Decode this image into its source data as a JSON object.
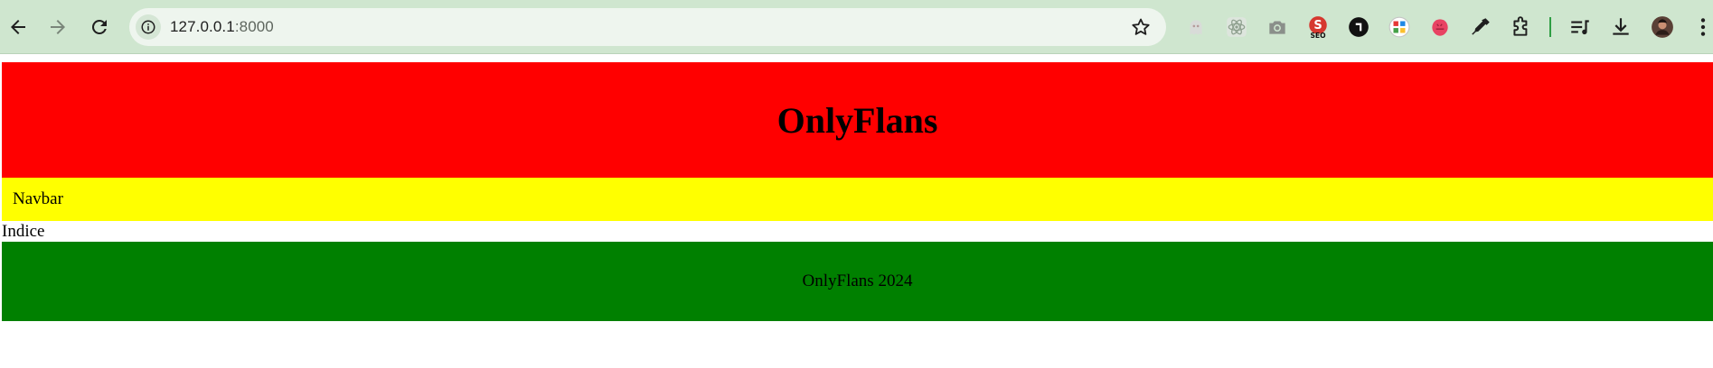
{
  "browser": {
    "url_host": "127.0.0.1",
    "url_port": ":8000",
    "extensions": [
      "ghost-extension-icon",
      "react-devtools-icon",
      "camera-icon",
      "seo-icon",
      "dark-circle-extension-icon",
      "color-grid-icon",
      "raspberry-icon",
      "eyedropper-icon",
      "puzzle-extensions-icon",
      "reading-list-icon",
      "download-icon",
      "profile-avatar",
      "kebab-menu-icon"
    ],
    "colors": {
      "toolbar_bg": "#cfe6cf",
      "omnibox_bg": "#eef5ee",
      "icon": "#1f1f1f"
    }
  },
  "page": {
    "header_title": "OnlyFlans",
    "navbar_label": "Navbar",
    "content_label": "Indice",
    "footer_text": "OnlyFlans 2024",
    "colors": {
      "header_bg": "#ff0000",
      "navbar_bg": "#ffff00",
      "footer_bg": "#008000"
    }
  }
}
